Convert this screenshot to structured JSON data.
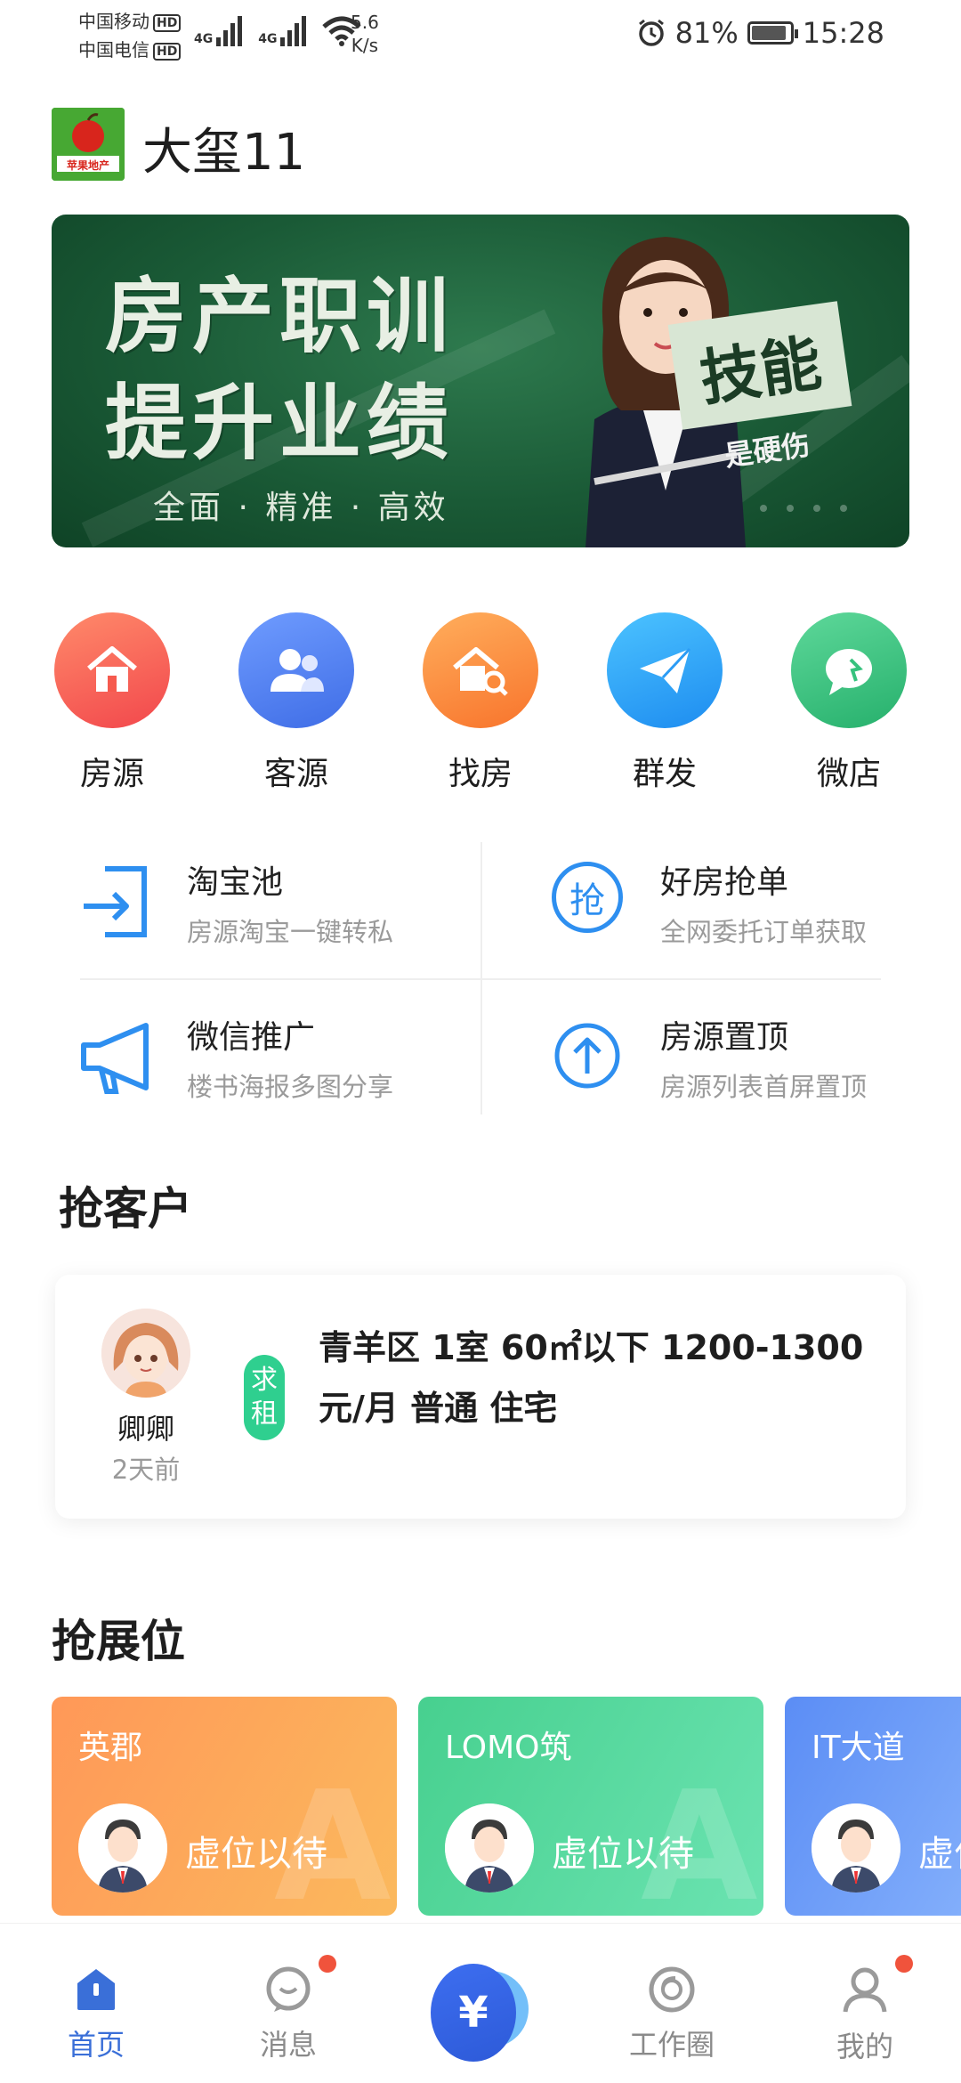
{
  "status_bar": {
    "carrier1": "中国移动",
    "carrier2": "中国电信",
    "hd": "HD",
    "net": "4G",
    "speed_value": "5.6",
    "speed_unit": "K/s",
    "battery": "81%",
    "time": "15:28"
  },
  "header": {
    "title": "大玺11",
    "logo_text": "苹果地产"
  },
  "banner": {
    "line1": "房产职训",
    "line2": "提升业绩",
    "sub": "全面 · 精准 · 高效",
    "skill": "技能",
    "skill_sub": "是硬伤"
  },
  "quick_actions": [
    {
      "label": "房源",
      "icon": "house-icon",
      "color": "#f65a4e"
    },
    {
      "label": "客源",
      "icon": "users-icon",
      "color": "#4d7ff0"
    },
    {
      "label": "找房",
      "icon": "house-search-icon",
      "color": "#fb8a3c"
    },
    {
      "label": "群发",
      "icon": "paper-plane-icon",
      "color": "#2b9cf5"
    },
    {
      "label": "微店",
      "icon": "chat-bubble-icon",
      "color": "#36c27e"
    }
  ],
  "features": [
    {
      "title": "淘宝池",
      "sub": "房源淘宝一键转私",
      "icon": "exit-door-icon"
    },
    {
      "title": "好房抢单",
      "sub": "全网委托订单获取",
      "icon": "grab-order-icon",
      "icon_text": "抢"
    },
    {
      "title": "微信推广",
      "sub": "楼书海报多图分享",
      "icon": "megaphone-icon"
    },
    {
      "title": "房源置顶",
      "sub": "房源列表首屏置顶",
      "icon": "arrow-up-circle-icon"
    }
  ],
  "grab_customer": {
    "title": "抢客户",
    "name": "卿卿",
    "time": "2天前",
    "tag": "求租",
    "line1": "青羊区 1室 60㎡以下 1200-1300",
    "line2": "元/月 普通 住宅"
  },
  "grab_booth": {
    "title": "抢展位",
    "items": [
      {
        "name": "英郡",
        "wait": "虚位以待",
        "color": "#f79a4a"
      },
      {
        "name": "LOMO筑",
        "wait": "虚位以待",
        "color": "#4fd69a"
      },
      {
        "name": "IT大道",
        "wait": "虚位以待",
        "color": "#6a9cf6"
      }
    ]
  },
  "nav": {
    "home": "首页",
    "messages": "消息",
    "center_symbol": "¥",
    "circle": "工作圈",
    "mine": "我的"
  }
}
